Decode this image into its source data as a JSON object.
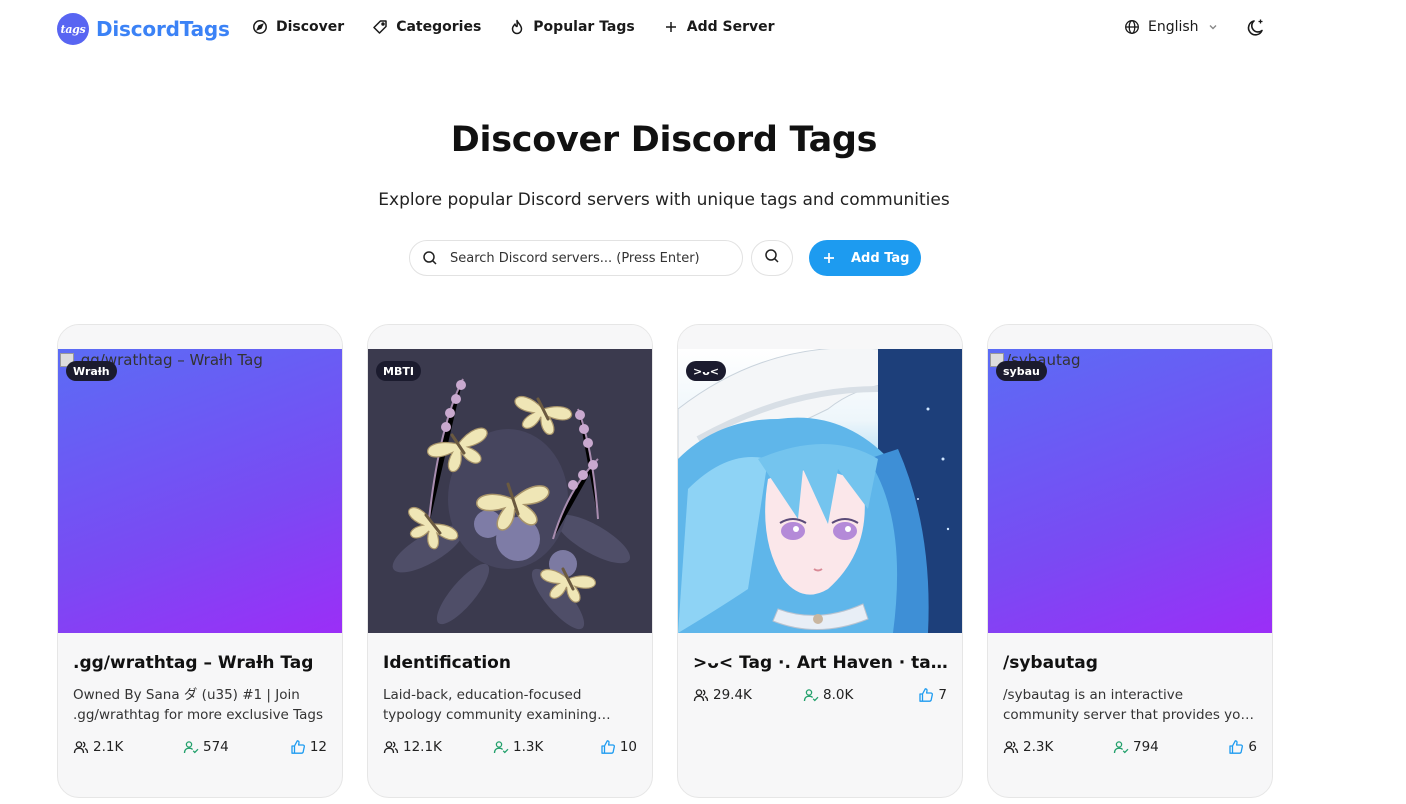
{
  "brand": {
    "logo_badge": "tags",
    "name": "DiscordTags",
    "color": "#3b82f6"
  },
  "nav": {
    "items": [
      {
        "label": "Discover",
        "icon": "compass-icon"
      },
      {
        "label": "Categories",
        "icon": "tag-icon"
      },
      {
        "label": "Popular Tags",
        "icon": "flame-icon"
      },
      {
        "label": "Add Server",
        "icon": "plus-icon"
      }
    ]
  },
  "language": {
    "label": "English",
    "icon": "globe-icon"
  },
  "theme_toggle": {
    "icon": "moon-icon"
  },
  "hero": {
    "title": "Discover Discord Tags",
    "subtitle": "Explore popular Discord servers with unique tags and communities"
  },
  "search": {
    "placeholder": "Search Discord servers... (Press Enter)",
    "value": ""
  },
  "add_tag": {
    "label": "Add Tag",
    "color": "#1d9bf0"
  },
  "cards": [
    {
      "alt": ".gg/wrathtag – Wraƚh Tag",
      "badge": "Wraƚh",
      "title": ".gg/wrathtag – Wraƚh Tag",
      "description": "Owned By Sana ダ (u35) #1 | Join .gg/wrathtag for more exclusive Tags",
      "members": "2.1K",
      "online": "574",
      "likes": "12"
    },
    {
      "badge": "MBTI",
      "title": "Identification",
      "description": "Laid-back, education-focused typology community examining personality",
      "members": "12.1K",
      "online": "1.3K",
      "likes": "10"
    },
    {
      "badge": ">ᴗ<",
      "title": ">ᴗ< Tag ·. Art Haven · tag server",
      "description": "",
      "members": "29.4K",
      "online": "8.0K",
      "likes": "7"
    },
    {
      "alt": "/sybautag",
      "badge": "sybau",
      "title": "/sybautag",
      "description": "/sybautag is an interactive community server that provides you a free guild tag",
      "members": "2.3K",
      "online": "794",
      "likes": "6"
    }
  ],
  "colors": {
    "online_icon": "#22a06b",
    "likes_icon": "#1d9bf0",
    "gradient_start": "#5b6cf5",
    "gradient_end": "#9b2ef7"
  }
}
